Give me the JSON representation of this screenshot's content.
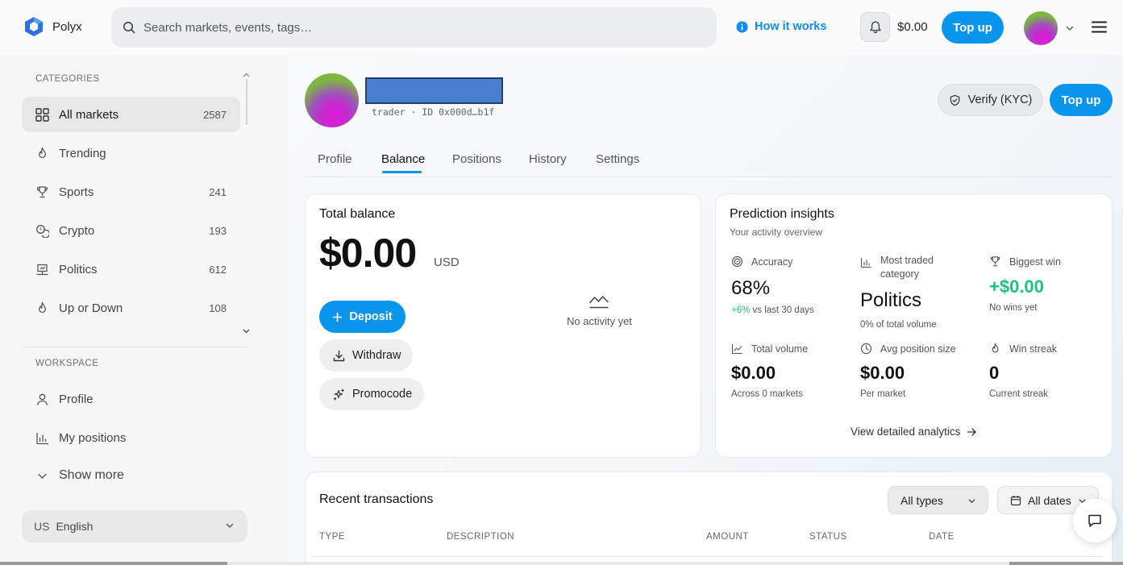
{
  "app": {
    "name": "Polyx"
  },
  "header": {
    "search_placeholder": "Search markets, events, tags…",
    "how_it_works": "How it works",
    "balance": "$0.00",
    "topup_label": "Top up"
  },
  "sidebar": {
    "categories_heading": "CATEGORIES",
    "categories": [
      {
        "label": "All markets",
        "count": "2587",
        "icon": "grid-icon"
      },
      {
        "label": "Trending",
        "count": "",
        "icon": "flame-icon"
      },
      {
        "label": "Sports",
        "count": "241",
        "icon": "trophy-icon"
      },
      {
        "label": "Crypto",
        "count": "193",
        "icon": "coins-icon"
      },
      {
        "label": "Politics",
        "count": "612",
        "icon": "podium-icon"
      },
      {
        "label": "Up or Down",
        "count": "108",
        "icon": "flame-icon"
      }
    ],
    "workspace_heading": "WORKSPACE",
    "workspace": [
      {
        "label": "Profile",
        "icon": "user-icon"
      },
      {
        "label": "My positions",
        "icon": "bar-chart-icon"
      }
    ],
    "show_more": "Show more",
    "language": {
      "flag": "US",
      "label": "English"
    }
  },
  "profile": {
    "meta": "trader · ID 0x000d…b1f",
    "verify_label": "Verify (KYC)",
    "topup_label": "Top up"
  },
  "tabs": [
    "Profile",
    "Balance",
    "Positions",
    "History",
    "Settings"
  ],
  "active_tab": "Balance",
  "balance_card": {
    "title": "Total balance",
    "amount": "$0.00",
    "currency": "USD",
    "deposit": "Deposit",
    "withdraw": "Withdraw",
    "promocode": "Promocode",
    "no_activity": "No activity yet"
  },
  "insights": {
    "title": "Prediction insights",
    "subtitle": "Your activity overview",
    "accuracy": {
      "label": "Accuracy",
      "value": "68%",
      "delta": "+6%",
      "delta_text": " vs last 30 days"
    },
    "most_traded": {
      "label": "Most traded category",
      "value": "Politics",
      "sub": "0% of total volume"
    },
    "biggest_win": {
      "label": "Biggest win",
      "value": "+$0.00",
      "sub": "No wins yet"
    },
    "total_volume": {
      "label": "Total volume",
      "value": "$0.00",
      "sub": "Across 0 markets"
    },
    "avg_position": {
      "label": "Avg position size",
      "value": "$0.00",
      "sub": "Per market"
    },
    "win_streak": {
      "label": "Win streak",
      "value": "0",
      "sub": "Current streak"
    },
    "view_link": "View detailed analytics"
  },
  "transactions": {
    "title": "Recent transactions",
    "type_filter": "All types",
    "date_filter": "All dates",
    "columns": [
      "TYPE",
      "DESCRIPTION",
      "AMOUNT",
      "STATUS",
      "DATE"
    ]
  },
  "colors": {
    "accent": "#0a95ec",
    "positive": "#1fc27a",
    "redaction": "#4a7ed0"
  }
}
